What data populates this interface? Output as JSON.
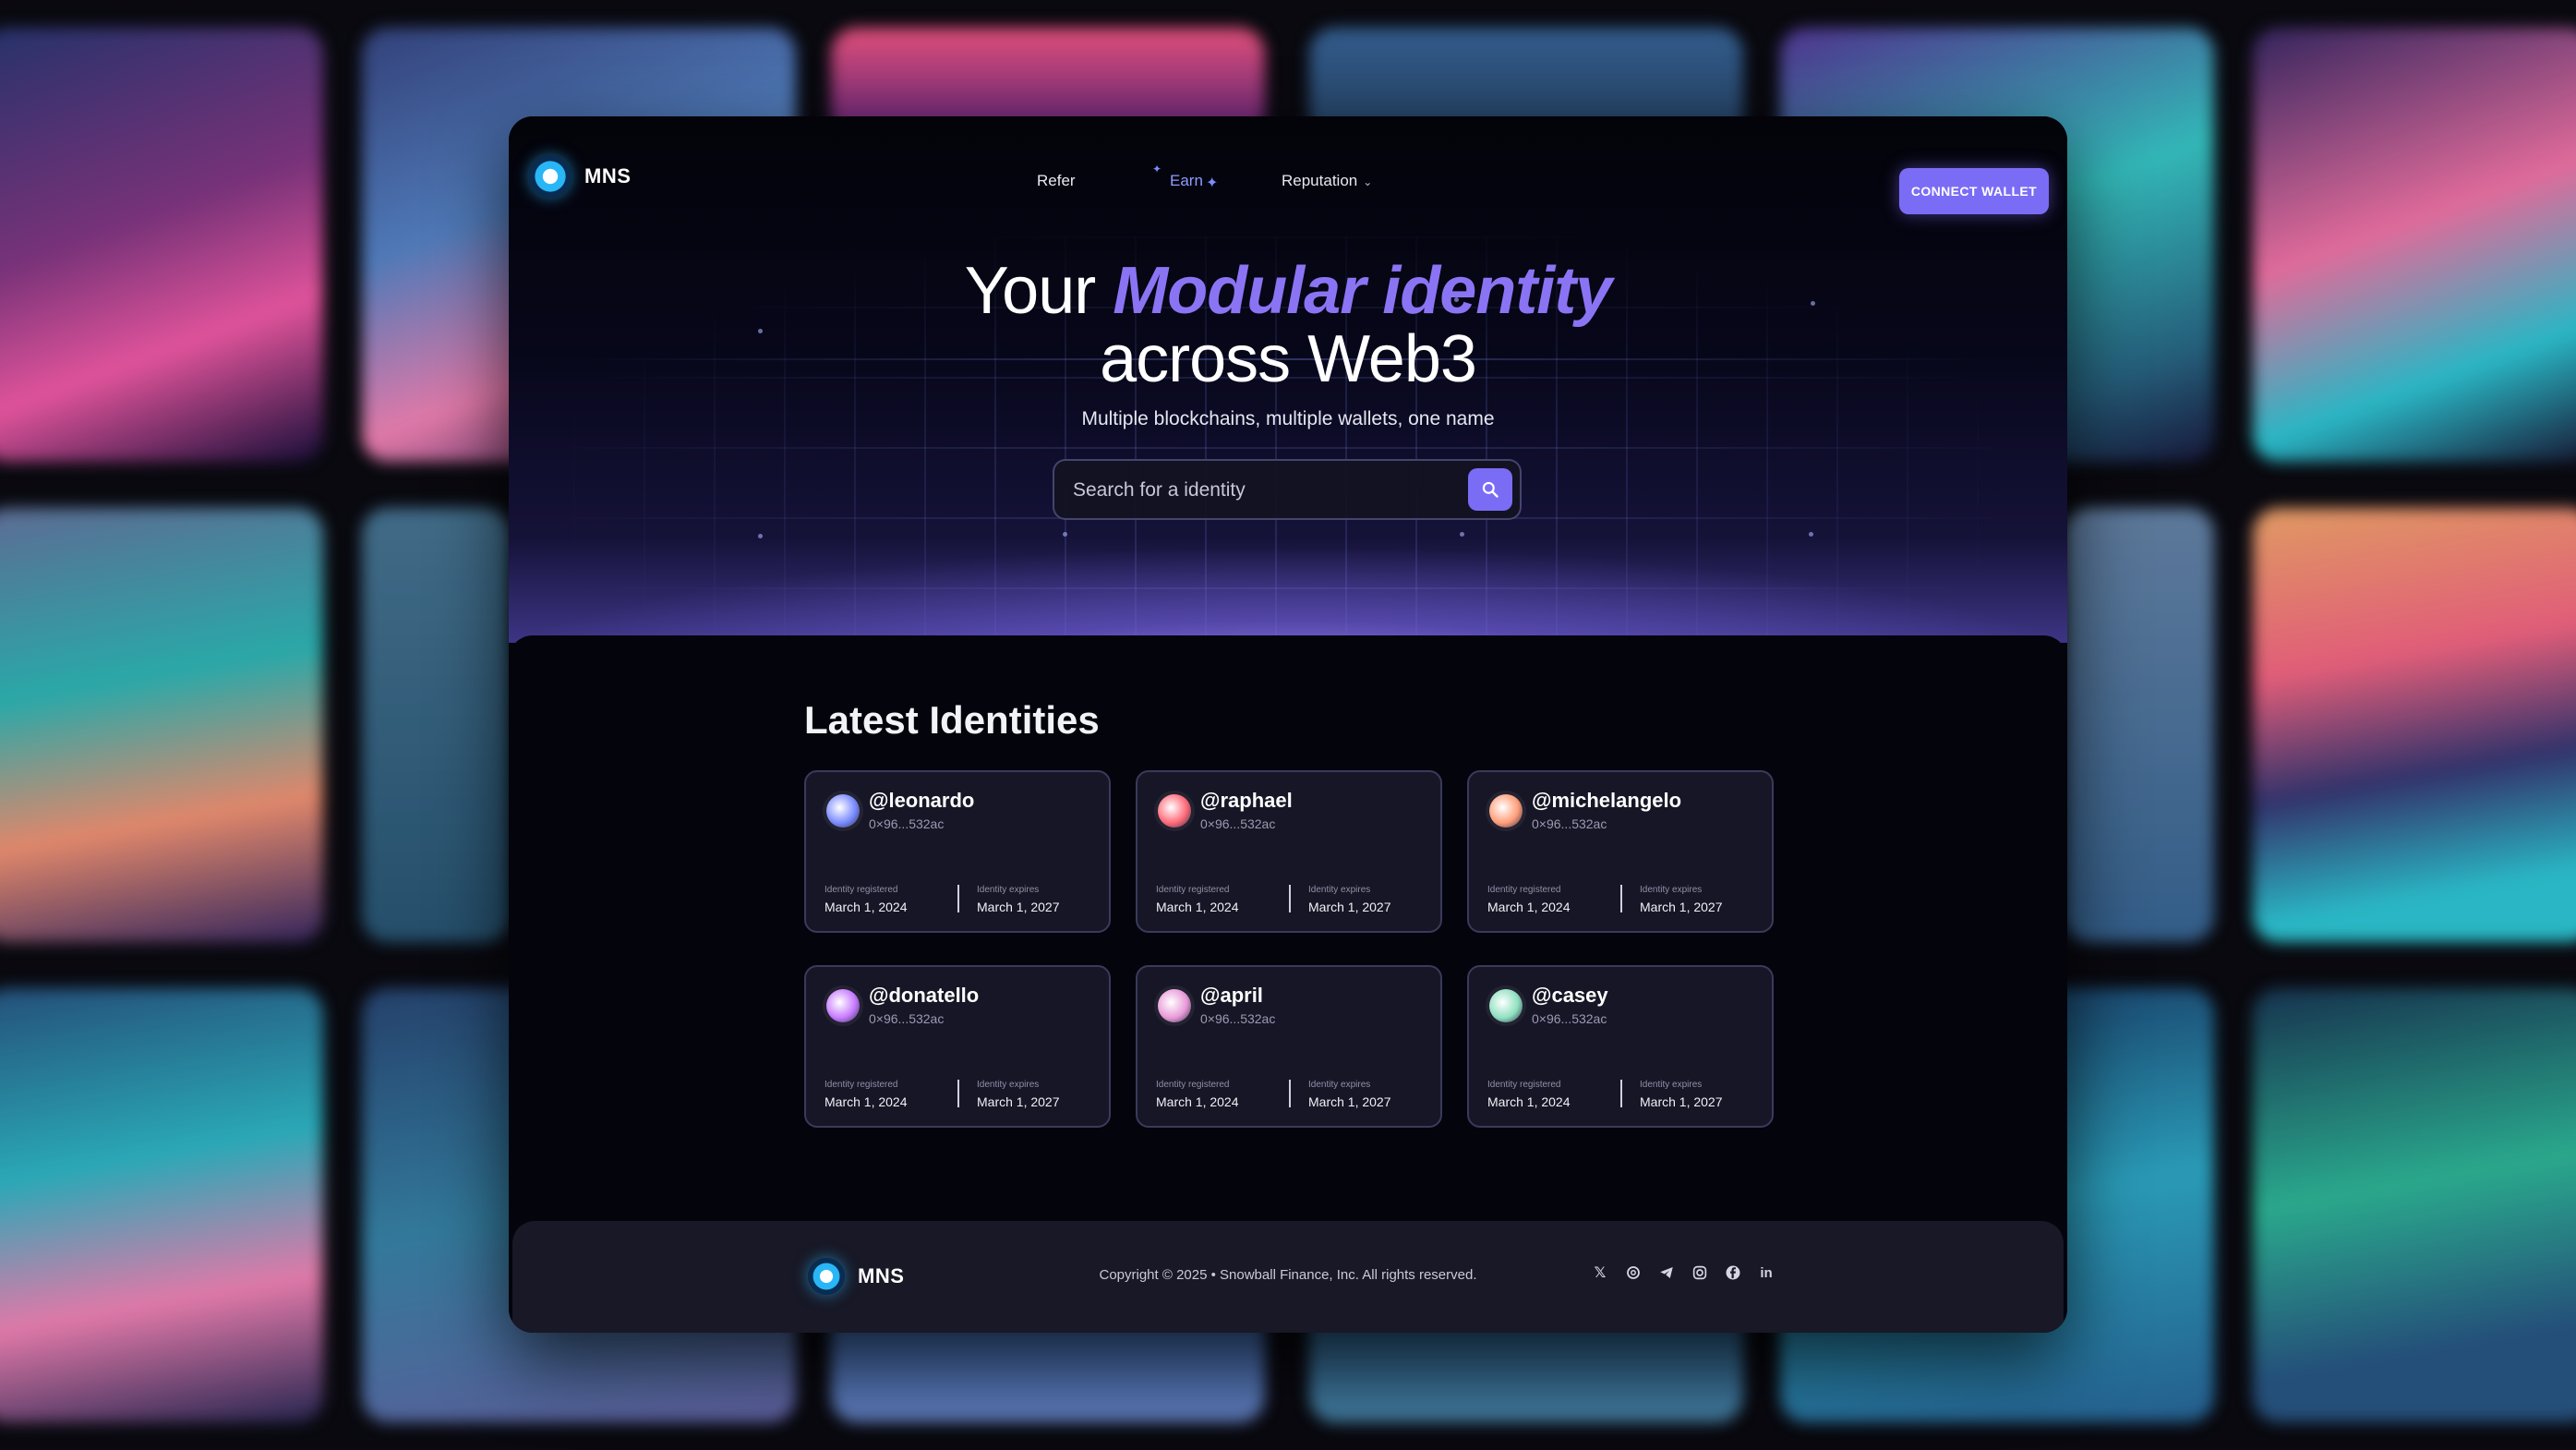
{
  "nav": {
    "brand": "MNS",
    "items": [
      {
        "label": "Refer"
      },
      {
        "label": "Earn"
      },
      {
        "label": "Reputation"
      }
    ],
    "connect_label": "CONNECT WALLET"
  },
  "hero": {
    "title_prefix": "Your",
    "title_accent": "Modular identity",
    "title_line2": "across Web3",
    "subtitle": "Multiple blockchains, multiple wallets, one name",
    "search_placeholder": "Search for a identity"
  },
  "latest": {
    "title": "Latest Identities",
    "registered_label": "Identity registered",
    "expires_label": "Identity expires",
    "cards": [
      {
        "handle": "@leonardo",
        "address": "0×96...532ac",
        "registered": "March 1, 2024",
        "expires": "March 1, 2027",
        "avatar_color": "#7b8cff"
      },
      {
        "handle": "@raphael",
        "address": "0×96...532ac",
        "registered": "March 1, 2024",
        "expires": "March 1, 2027",
        "avatar_color": "#ff6b7a"
      },
      {
        "handle": "@michelangelo",
        "address": "0×96...532ac",
        "registered": "March 1, 2024",
        "expires": "March 1, 2027",
        "avatar_color": "#ff9e7a"
      },
      {
        "handle": "@donatello",
        "address": "0×96...532ac",
        "registered": "March 1, 2024",
        "expires": "March 1, 2027",
        "avatar_color": "#c77bff"
      },
      {
        "handle": "@april",
        "address": "0×96...532ac",
        "registered": "March 1, 2024",
        "expires": "March 1, 2027",
        "avatar_color": "#e89ad8"
      },
      {
        "handle": "@casey",
        "address": "0×96...532ac",
        "registered": "March 1, 2024",
        "expires": "March 1, 2027",
        "avatar_color": "#8fe0c0"
      }
    ]
  },
  "footer": {
    "brand": "MNS",
    "copyright": "Copyright © 2025 • Snowball Finance, Inc. All rights reserved.",
    "social": [
      "x-icon",
      "threads-icon",
      "telegram-icon",
      "instagram-icon",
      "facebook-icon",
      "linkedin-icon"
    ]
  },
  "colors": {
    "accent": "#7b6cf6",
    "headline_accent": "#8b74f4",
    "card_bg": "#161626",
    "card_border": "#3a3a5c",
    "logo_blue": "#29b6f6"
  }
}
